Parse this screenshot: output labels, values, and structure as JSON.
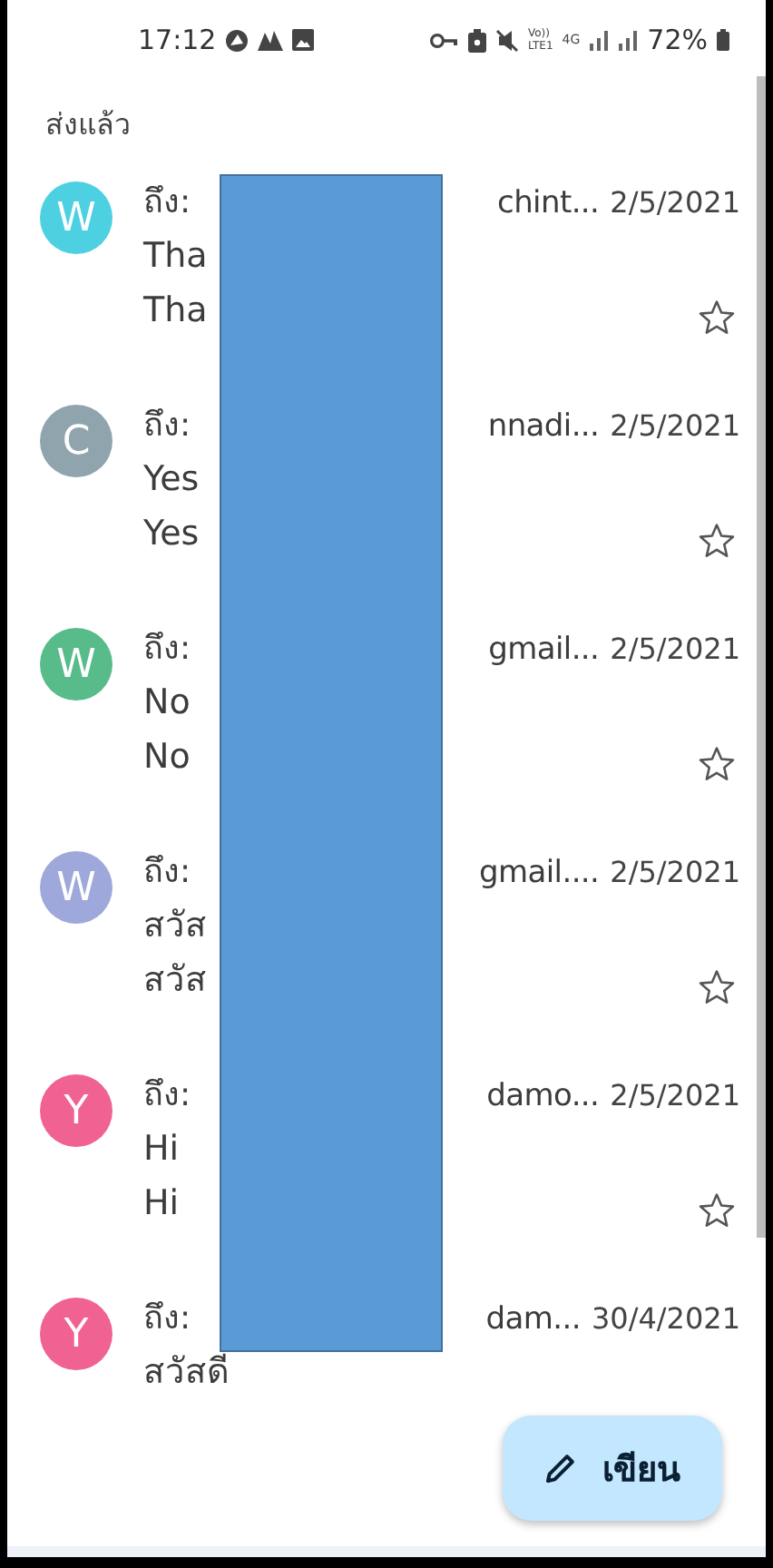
{
  "status_bar": {
    "time": "17:12",
    "volte": [
      "Vo))",
      "LTE1"
    ],
    "network": "4G",
    "battery": "72%"
  },
  "folder_title": "ส่งแล้ว",
  "rows": [
    {
      "avatar": "W",
      "color": "#4dd0e1",
      "to": "ถึง:",
      "recipient_tail": "chint...",
      "date": "2/5/2021",
      "lines": [
        "Tha",
        "Tha"
      ],
      "starred": false
    },
    {
      "avatar": "C",
      "color": "#90a4ae",
      "to": "ถึง:",
      "recipient_tail": "nnadi...",
      "date": "2/5/2021",
      "lines": [
        "Yes",
        "Yes"
      ],
      "starred": false
    },
    {
      "avatar": "W",
      "color": "#57bb8a",
      "to": "ถึง:",
      "recipient_tail": "gmail...",
      "date": "2/5/2021",
      "lines": [
        "No",
        "No"
      ],
      "starred": false
    },
    {
      "avatar": "W",
      "color": "#9fa8da",
      "to": "ถึง:",
      "recipient_tail": "gmail....",
      "date": "2/5/2021",
      "lines": [
        "สวัส",
        "สวัส"
      ],
      "starred": false
    },
    {
      "avatar": "Y",
      "color": "#f06292",
      "to": "ถึง:",
      "recipient_tail": "damo...",
      "date": "2/5/2021",
      "lines": [
        "Hi",
        "Hi"
      ],
      "starred": false
    },
    {
      "avatar": "Y",
      "color": "#f06292",
      "to": "ถึง:",
      "recipient_tail": "dam...",
      "date": "30/4/2021",
      "lines": [
        "สวัสดี"
      ]
    }
  ],
  "compose_button": "เขียน"
}
